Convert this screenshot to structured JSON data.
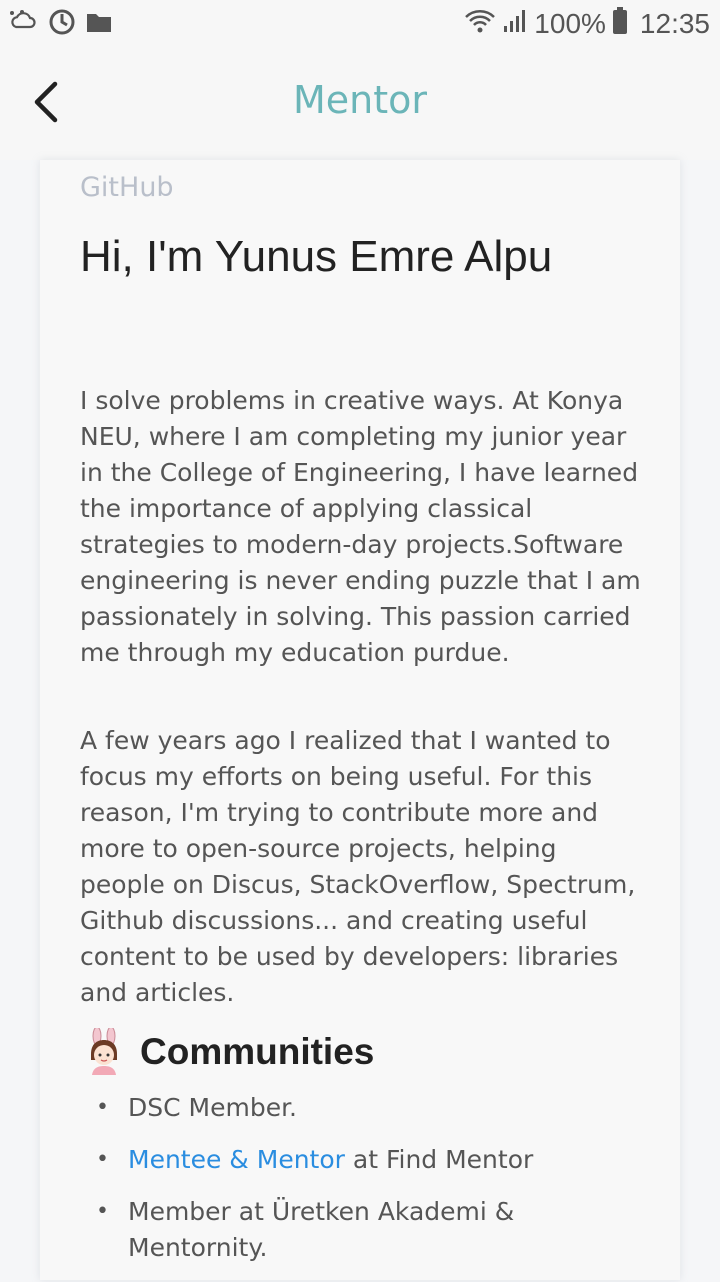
{
  "status_bar": {
    "battery": "100%",
    "time": "12:35"
  },
  "app_bar": {
    "title": "Mentor"
  },
  "profile": {
    "source": "GitHub",
    "heading": "Hi, I'm Yunus Emre Alpu",
    "paragraphs": [
      "I solve problems in creative ways. At Konya NEU, where I am completing my junior year in the College of Engineering, I have learned the importance of applying classical strategies to modern-day projects.Software engineering is never ending puzzle that I am passionately in solving. This passion carried me through my education purdue.",
      "A few years ago I realized that I wanted to focus my efforts on being useful. For this reason, I'm trying to contribute more and more to open-source projects, helping people on Discus, StackOverflow, Spectrum, Github discussions... and creating useful content to be used by developers: libraries and articles."
    ],
    "communities": {
      "title": "Communities",
      "items": [
        {
          "text": "DSC Member."
        },
        {
          "link": "Mentee & Mentor",
          "text": " at Find Mentor"
        },
        {
          "text": "Member at Üretken Akademi & Mentornity."
        }
      ]
    }
  },
  "colors": {
    "accent": "#6bb5b8",
    "link": "#2a8de0"
  }
}
